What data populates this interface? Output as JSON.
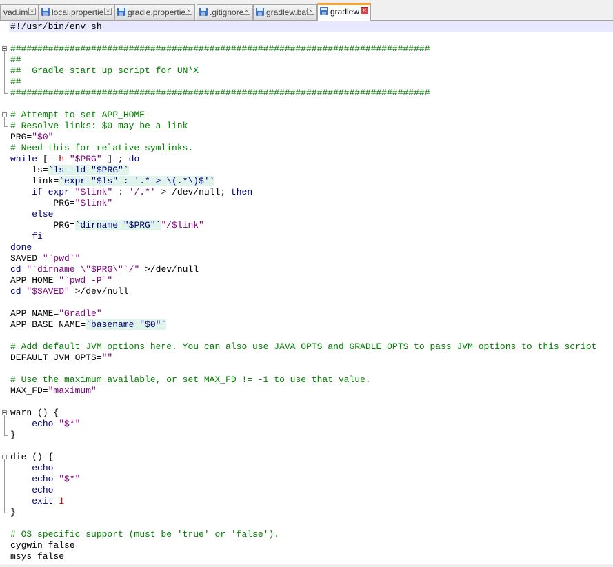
{
  "tabs": [
    {
      "label": "vad.iml",
      "active": false
    },
    {
      "label": "local.properties",
      "active": false
    },
    {
      "label": "gradle.properties",
      "active": false
    },
    {
      "label": ".gitignore",
      "active": false
    },
    {
      "label": "gradlew.bat",
      "active": false
    },
    {
      "label": "gradlew",
      "active": true
    }
  ],
  "colors": {
    "comment": "#008000",
    "keyword": "#00007f",
    "string": "#7f007f",
    "number": "#cc0000",
    "active_tab_accent": "#f8a332",
    "current_line": "#e8e8ff",
    "highlight": "#e0f4ec"
  },
  "code_lines": [
    [
      [
        "id",
        "#!/usr/bin/env sh"
      ]
    ],
    [],
    [
      [
        "com",
        "##############################################################################"
      ]
    ],
    [
      [
        "com",
        "##"
      ]
    ],
    [
      [
        "com",
        "##  Gradle start up script for UN*X"
      ]
    ],
    [
      [
        "com",
        "##"
      ]
    ],
    [
      [
        "com",
        "##############################################################################"
      ]
    ],
    [],
    [
      [
        "com",
        "# Attempt to set APP_HOME"
      ]
    ],
    [
      [
        "com",
        "# Resolve links: $0 may be a link"
      ]
    ],
    [
      [
        "id",
        "PRG="
      ],
      [
        "dq",
        "\"$0\""
      ]
    ],
    [
      [
        "com",
        "# Need this for relative symlinks."
      ]
    ],
    [
      [
        "kw",
        "while"
      ],
      [
        "id",
        " [ "
      ],
      [
        "op",
        "-h"
      ],
      [
        "id",
        " "
      ],
      [
        "dq",
        "\"$PRG\""
      ],
      [
        "id",
        " ] ; "
      ],
      [
        "kw",
        "do"
      ]
    ],
    [
      [
        "id",
        "    ls="
      ],
      [
        "bt",
        "`ls -ld \"$PRG\"`",
        "hl"
      ]
    ],
    [
      [
        "id",
        "    link="
      ],
      [
        "bt",
        "`expr \"$ls\" : '.*-> \\(.*\\)$'`",
        "hl"
      ]
    ],
    [
      [
        "id",
        "    "
      ],
      [
        "kw",
        "if"
      ],
      [
        "id",
        " "
      ],
      [
        "kw",
        "expr"
      ],
      [
        "id",
        " "
      ],
      [
        "dq",
        "\"$link\""
      ],
      [
        "id",
        " : "
      ],
      [
        "dq",
        "'/.*'"
      ],
      [
        "id",
        " > /dev/null; "
      ],
      [
        "kw",
        "then"
      ]
    ],
    [
      [
        "id",
        "        PRG="
      ],
      [
        "dq",
        "\"$link\""
      ]
    ],
    [
      [
        "id",
        "    "
      ],
      [
        "kw",
        "else"
      ]
    ],
    [
      [
        "id",
        "        PRG="
      ],
      [
        "bt",
        "`dirname \"$PRG\"`",
        "hl"
      ],
      [
        "dq",
        "\"/$link\""
      ]
    ],
    [
      [
        "id",
        "    "
      ],
      [
        "kw",
        "fi"
      ]
    ],
    [
      [
        "kw",
        "done"
      ]
    ],
    [
      [
        "id",
        "SAVED="
      ],
      [
        "dq",
        "\"`pwd`\""
      ]
    ],
    [
      [
        "kw",
        "cd"
      ],
      [
        "id",
        " "
      ],
      [
        "dq",
        "\"`dirname \\\"$PRG\\\"`/\""
      ],
      [
        "id",
        " >/dev/null"
      ]
    ],
    [
      [
        "id",
        "APP_HOME="
      ],
      [
        "dq",
        "\"`pwd -P`\""
      ]
    ],
    [
      [
        "kw",
        "cd"
      ],
      [
        "id",
        " "
      ],
      [
        "dq",
        "\"$SAVED\""
      ],
      [
        "id",
        " >/dev/null"
      ]
    ],
    [],
    [
      [
        "id",
        "APP_NAME="
      ],
      [
        "dq",
        "\"Gradle\""
      ]
    ],
    [
      [
        "id",
        "APP_BASE_NAME="
      ],
      [
        "bt",
        "`basename \"$0\"`",
        "hl"
      ]
    ],
    [],
    [
      [
        "com",
        "# Add default JVM options here. You can also use JAVA_OPTS and GRADLE_OPTS to pass JVM options to this script"
      ]
    ],
    [
      [
        "id",
        "DEFAULT_JVM_OPTS="
      ],
      [
        "dq",
        "\"\""
      ]
    ],
    [],
    [
      [
        "com",
        "# Use the maximum available, or set MAX_FD != -1 to use that value."
      ]
    ],
    [
      [
        "id",
        "MAX_FD="
      ],
      [
        "dq",
        "\"maximum\""
      ]
    ],
    [],
    [
      [
        "id",
        "warn () {"
      ]
    ],
    [
      [
        "id",
        "    "
      ],
      [
        "kw",
        "echo"
      ],
      [
        "id",
        " "
      ],
      [
        "dq",
        "\"$*\""
      ]
    ],
    [
      [
        "id",
        "}"
      ]
    ],
    [],
    [
      [
        "id",
        "die () {"
      ]
    ],
    [
      [
        "id",
        "    "
      ],
      [
        "kw",
        "echo"
      ]
    ],
    [
      [
        "id",
        "    "
      ],
      [
        "kw",
        "echo"
      ],
      [
        "id",
        " "
      ],
      [
        "dq",
        "\"$*\""
      ]
    ],
    [
      [
        "id",
        "    "
      ],
      [
        "kw",
        "echo"
      ]
    ],
    [
      [
        "id",
        "    "
      ],
      [
        "kw",
        "exit"
      ],
      [
        "id",
        " "
      ],
      [
        "num",
        "1"
      ]
    ],
    [
      [
        "id",
        "}"
      ]
    ],
    [],
    [
      [
        "com",
        "# OS specific support (must be 'true' or 'false')."
      ]
    ],
    [
      [
        "id",
        "cygwin=false"
      ]
    ],
    [
      [
        "id",
        "msys=false"
      ]
    ]
  ]
}
